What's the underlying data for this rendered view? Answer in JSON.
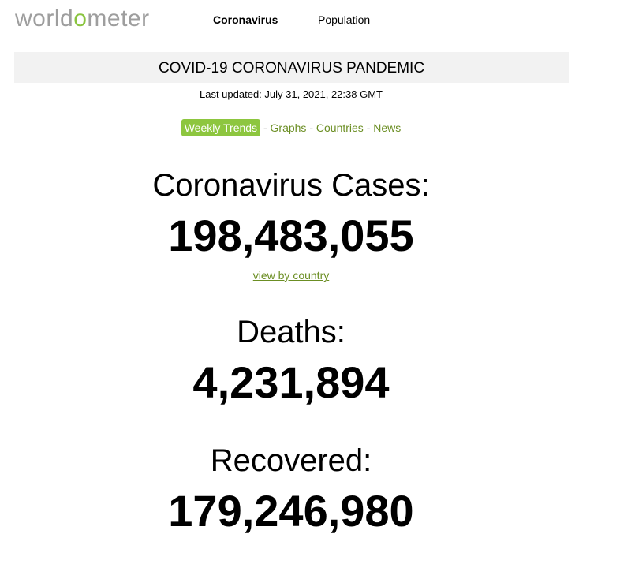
{
  "navbar": {
    "logo_part1": "worldo",
    "logo_accent": "",
    "logo_text_before": "worldo",
    "logo": {
      "prefix": "world",
      "accent": "o",
      "suffix": "meter"
    },
    "items": [
      "Coronavirus",
      "Population"
    ]
  },
  "banner": {
    "title": "COVID-19 CORONAVIRUS PANDEMIC"
  },
  "last_updated": "Last updated: July 31, 2021, 22:38 GMT",
  "links": {
    "weekly_trends": "Weekly Trends",
    "graphs": "Graphs",
    "countries": "Countries",
    "news": "News",
    "separator": " - "
  },
  "stats": {
    "cases_label": "Coronavirus Cases:",
    "cases_value": "198,483,055",
    "view_by_country": "view by country",
    "deaths_label": "Deaths:",
    "deaths_value": "4,231,894",
    "recovered_label": "Recovered:",
    "recovered_value": "179,246,980"
  },
  "colors": {
    "accent_green": "#8dc63f",
    "link_green": "#6b8e23",
    "logo_gray": "#9e9e9e",
    "banner_bg": "#f2f2f2"
  }
}
